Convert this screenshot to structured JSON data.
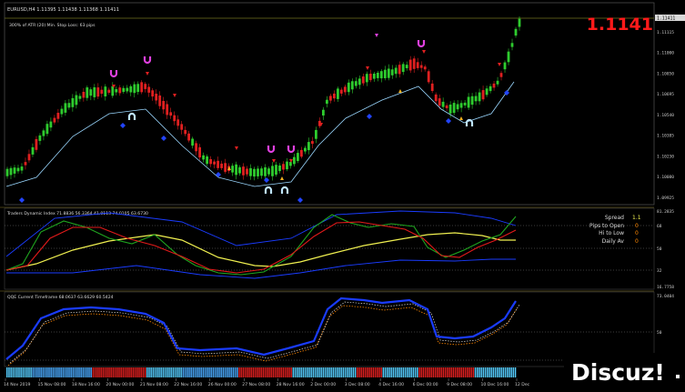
{
  "colors": {
    "background": "#000000",
    "bull_candle": "#2ecc2e",
    "bear_candle": "#e02020",
    "atr_band": "#9ad7ff",
    "price_highlight": "#ff1a1a",
    "tdi_green": "#1fa51f",
    "tdi_red": "#e21a1a",
    "tdi_yellow": "#f0f050",
    "tdi_blue": "#1a3cff",
    "qqe_blue": "#1a3cff",
    "qqe_orange": "#ff8800",
    "sep_gold": "#8a7a2a"
  },
  "main_chart": {
    "symbol_header": "EURUSD,H4  1.11395 1.11438 1.11368 1.11411",
    "indicator_label": "300% of ATR (20)     Min. Stop Loss:  63 pips",
    "big_price": "1.1141",
    "current_price_tag": "1.11411",
    "price_labels": [
      "1.11405",
      "1.11115",
      "1.11000",
      "1.10850",
      "1.10695",
      "1.10540",
      "1.10385",
      "1.10230",
      "1.10080",
      "1.09925"
    ]
  },
  "tdi_panel": {
    "title": "Traders Dynamic Index 71.8836 56.3364 41.0113 74.0105 63.6730",
    "axis_top": "81.2835",
    "axis_labels": [
      "68",
      "50",
      "32"
    ],
    "axis_bottom": "16.7758",
    "info": [
      {
        "label": "Spread",
        "value": "1.1"
      },
      {
        "label": "Pips to Open",
        "value": "0"
      },
      {
        "label": "Hi to Low",
        "value": "0"
      },
      {
        "label": "Daily Av",
        "value": "0"
      }
    ]
  },
  "qqe_panel": {
    "title": "QQE Current Timeframe 68.0637 63.6629 60.5424",
    "axis_top": "73.0404",
    "axis_labels": [
      "50",
      "30"
    ]
  },
  "time_axis": [
    "14 Nov 2019",
    "15 Nov 08:00",
    "18 Nov 16:00",
    "20 Nov 00:00",
    "21 Nov 08:00",
    "22 Nov 16:00",
    "26 Nov 00:00",
    "27 Nov 08:00",
    "28 Nov 16:00",
    "2 Dec 00:00",
    "3 Dec 08:00",
    "4 Dec 16:00",
    "6 Dec 00:00",
    "9 Dec 08:00",
    "10 Dec 16:00",
    "12 Dec"
  ],
  "watermark": "Discuz!"
}
